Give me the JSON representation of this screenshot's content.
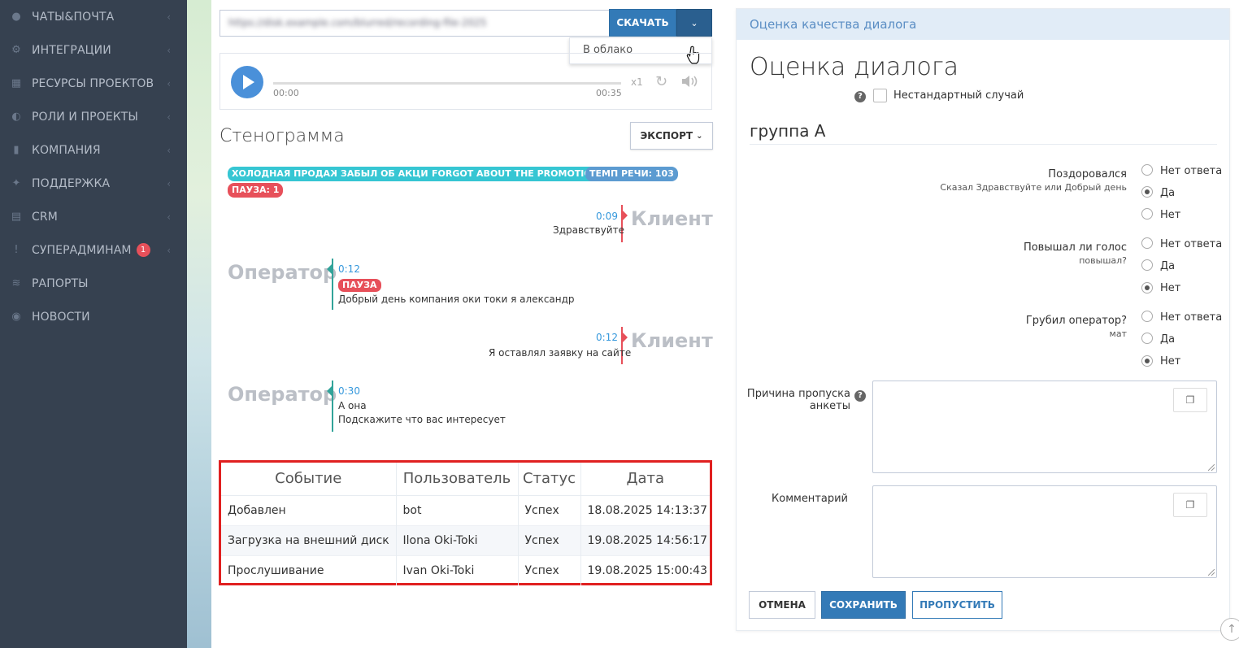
{
  "sidebar": {
    "items": [
      {
        "label": "ЧАТЫ&ПОЧТА",
        "icon": "chat-icon",
        "badge": null
      },
      {
        "label": "ИНТЕГРАЦИИ",
        "icon": "cogs-icon",
        "badge": null
      },
      {
        "label": "РЕСУРСЫ ПРОЕКТОВ",
        "icon": "grid-icon",
        "badge": null
      },
      {
        "label": "РОЛИ И ПРОЕКТЫ",
        "icon": "toggle-icon",
        "badge": null
      },
      {
        "label": "КОМПАНИЯ",
        "icon": "bar-chart-icon",
        "badge": null
      },
      {
        "label": "ПОДДЕРЖКА",
        "icon": "wrench-icon",
        "badge": null
      },
      {
        "label": "CRM",
        "icon": "list-icon",
        "badge": null
      },
      {
        "label": "СУПЕРАДМИНАМ",
        "icon": "exclamation-icon",
        "badge": "1"
      },
      {
        "label": "РАПОРТЫ",
        "icon": "line-chart-icon",
        "badge": null
      },
      {
        "label": "НОВОСТИ",
        "icon": "bell-icon",
        "badge": null
      }
    ]
  },
  "download": {
    "url_value": "https://disk.example.com/blurred/recording-file-2025",
    "download_label": "СКАЧАТЬ",
    "menu_item": "В облако"
  },
  "player": {
    "current_time": "00:00",
    "total_time": "00:35",
    "speed": "x1",
    "progress": 0
  },
  "transcript": {
    "title": "Стенограмма",
    "export_label": "ЭКСПОРТ",
    "tags": [
      "ХОЛОДНАЯ ПРОДАЖА",
      "ЗАБЫЛ ОБ АКЦИИ",
      "FORGOT ABOUT THE PROMOTION",
      "ТЕМП РЕЧИ: 103",
      "ПАУЗА: 1"
    ],
    "messages": [
      {
        "speaker": "Клиент",
        "time": "0:09",
        "lines": [
          "Здравствуйте"
        ],
        "pause": null
      },
      {
        "speaker": "Оператор",
        "time": "0:12",
        "lines": [
          "Добрый день компания оки токи я александр"
        ],
        "pause": "ПАУЗА"
      },
      {
        "speaker": "Клиент",
        "time": "0:12",
        "lines": [
          "Я оставлял заявку на сайте"
        ],
        "pause": null
      },
      {
        "speaker": "Оператор",
        "time": "0:30",
        "lines": [
          "А она",
          "Подскажите что вас интересует"
        ],
        "pause": null
      }
    ]
  },
  "events": {
    "headers": [
      "Событие",
      "Пользователь",
      "Статус",
      "Дата"
    ],
    "rows": [
      [
        "Добавлен",
        "bot",
        "Успех",
        "18.08.2025 14:13:37"
      ],
      [
        "Загрузка на внешний диск",
        "Ilona Oki-Toki",
        "Успех",
        "19.08.2025 14:56:17"
      ],
      [
        "Прослушивание",
        "Ivan Oki-Toki",
        "Успех",
        "19.08.2025 15:00:43"
      ]
    ]
  },
  "evaluation": {
    "header": "Оценка качества диалога",
    "title": "Оценка диалога",
    "nonstandard_label": "Нестандартный случай",
    "group_title": "группа А",
    "questions": [
      {
        "label": "Поздоровался",
        "sub": "Сказал Здравствуйте или Добрый день",
        "options": [
          "Нет ответа",
          "Да",
          "Нет"
        ],
        "selected": "Да"
      },
      {
        "label": "Повышал ли голос",
        "sub": "повышал?",
        "options": [
          "Нет ответа",
          "Да",
          "Нет"
        ],
        "selected": "Нет"
      },
      {
        "label": "Грубил оператор?",
        "sub": "мат",
        "options": [
          "Нет ответа",
          "Да",
          "Нет"
        ],
        "selected": "Нет"
      }
    ],
    "skip_reason_label": "Причина пропуска анкеты",
    "comment_label": "Комментарий",
    "cancel_label": "ОТМЕНА",
    "save_label": "СОХРАНИТЬ",
    "skip_label": "ПРОПУСТИТЬ"
  },
  "colors": {
    "sidebar_bg": "#364150",
    "primary": "#337ab7",
    "teal_tag": "#36c6d3",
    "red": "#e7505a",
    "highlight_box": "#e02020"
  }
}
